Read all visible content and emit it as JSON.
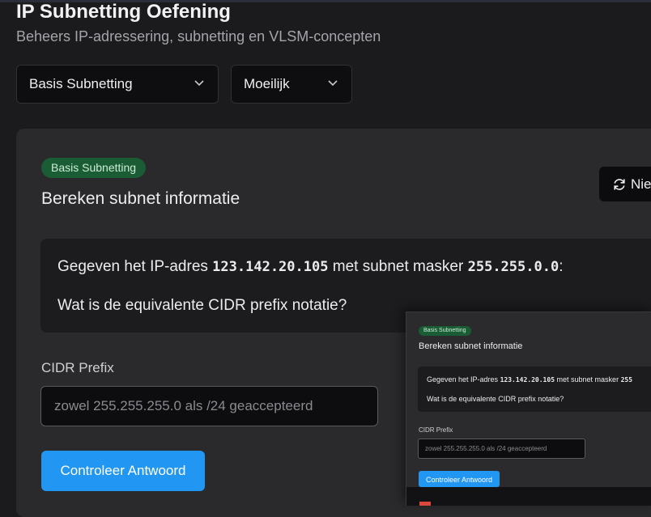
{
  "header": {
    "title": "IP Subnetting Oefening",
    "subtitle": "Beheers IP-adressering, subnetting en VLSM-concepten"
  },
  "filters": {
    "topic_select": "Basis Subnetting",
    "difficulty_select": "Moeilijk"
  },
  "exercise": {
    "badge": "Basis Subnetting",
    "title": "Bereken subnet informatie",
    "new_button": "Nie",
    "q_prefix": "Gegeven het IP-adres",
    "ip": "123.142.20.105",
    "q_mid": "met subnet masker",
    "mask": "255.255.0.0",
    "q_suffix": ":",
    "question": "Wat is de equivalente CIDR prefix notatie?",
    "field_label": "CIDR Prefix",
    "placeholder": "zowel 255.255.255.0 als /24 geaccepteerd",
    "submit": "Controleer Antwoord"
  },
  "preview": {
    "badge": "Basis Subnetting",
    "title": "Bereken subnet informatie",
    "q_prefix": "Gegeven het IP-adres",
    "ip": "123.142.20.105",
    "q_mid": "met subnet masker",
    "mask_partial": "255",
    "question": "Wat is de equivalente CIDR prefix notatie?",
    "field_label": "CIDR Prefix",
    "placeholder": "zowel 255.255.255.0 als /24 geaccepteerd",
    "submit": "Controleer Antwoord"
  },
  "colors": {
    "accent": "#2196f3",
    "badge_bg": "#1a5c33",
    "background": "#1b1b1d",
    "card": "#2a2a2c"
  },
  "icons": [
    "chevron-down-icon",
    "refresh-icon"
  ]
}
